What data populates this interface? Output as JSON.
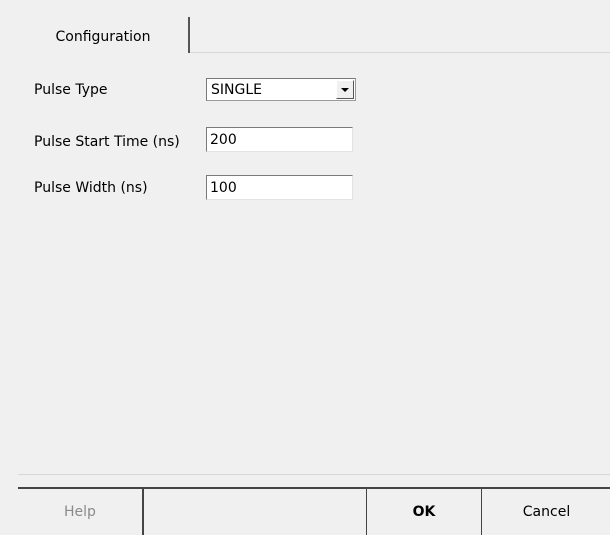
{
  "tabs": [
    {
      "label": "Configuration",
      "active": true
    }
  ],
  "form": {
    "pulse_type": {
      "label": "Pulse Type",
      "value": "SINGLE"
    },
    "pulse_start_time": {
      "label": "Pulse Start Time (ns)",
      "value": "200"
    },
    "pulse_width": {
      "label": "Pulse Width (ns)",
      "value": "100"
    }
  },
  "buttons": {
    "help": "Help",
    "ok": "OK",
    "cancel": "Cancel"
  },
  "colors": {
    "background": "#f0f0f0",
    "disabled_text": "#8a8a8a"
  }
}
